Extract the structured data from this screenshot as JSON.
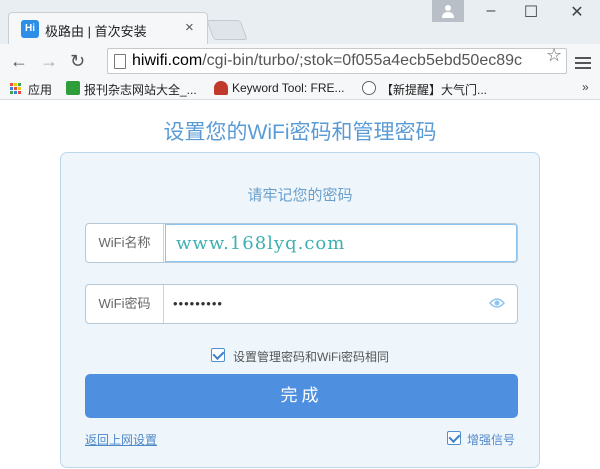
{
  "browser": {
    "tab_title": "极路由 | 首次安装",
    "tab_logo": "Hi",
    "url_host": "hiwifi.com",
    "url_path": "/cgi-bin/turbo/;stok=0f055a4ecb5ebd50ec89c",
    "bookmarks": [
      {
        "label": "应用"
      },
      {
        "label": "报刊杂志网站大全_..."
      },
      {
        "label": "Keyword Tool: FRE..."
      },
      {
        "label": "【新提醒】大气门..."
      }
    ],
    "bookmarks_more": "»",
    "tab_close": "×",
    "back": "←",
    "forward": "→",
    "reload": "↻",
    "star": "☆",
    "minimize": "–",
    "maximize": "☐",
    "close": "✕"
  },
  "page": {
    "title": "设置您的WiFi密码和管理密码",
    "subtitle": "请牢记您的密码",
    "wifi_name_label": "WiFi名称",
    "wifi_name_value": "www.168lyq.com",
    "wifi_password_label": "WiFi密码",
    "wifi_password_value": "•••••••••",
    "sync_checkbox_label": "设置管理密码和WiFi密码相同",
    "submit_label": "完成",
    "back_link": "返回上网设置",
    "enhance_label": "增强信号"
  },
  "colors": {
    "accent": "#4f8fe0",
    "title": "#5b9bd5",
    "card_bg": "#eef6fb"
  }
}
